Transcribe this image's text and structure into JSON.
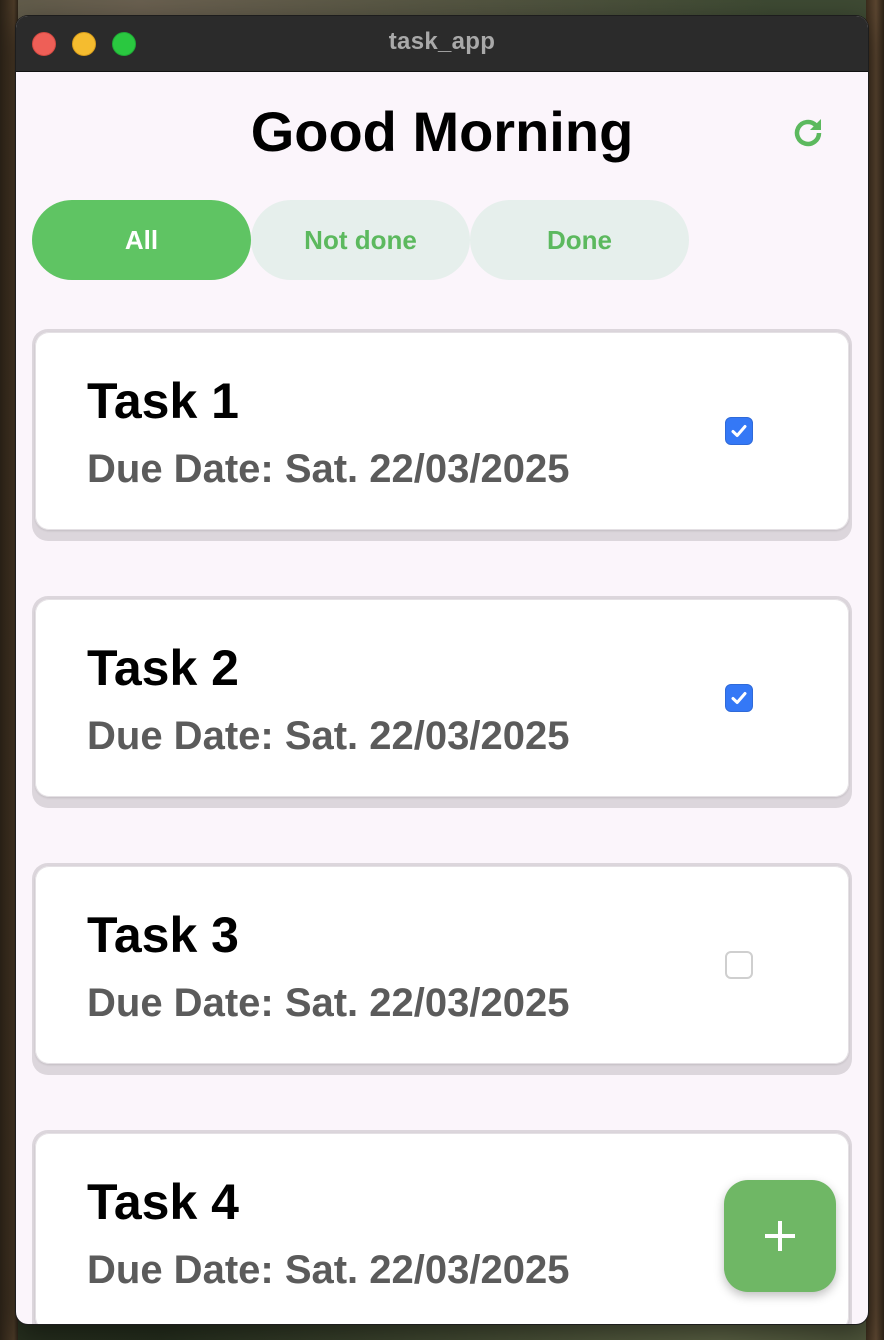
{
  "window": {
    "title": "task_app",
    "controls": [
      "close",
      "minimize",
      "maximize"
    ]
  },
  "header": {
    "greeting": "Good Morning",
    "refresh_icon": "refresh-icon"
  },
  "filters": [
    {
      "label": "All",
      "active": true
    },
    {
      "label": "Not done",
      "active": false
    },
    {
      "label": "Done",
      "active": false
    }
  ],
  "tasks": [
    {
      "title": "Task 1",
      "due": "Due Date: Sat. 22/03/2025",
      "done": true
    },
    {
      "title": "Task 2",
      "due": "Due Date: Sat. 22/03/2025",
      "done": true
    },
    {
      "title": "Task 3",
      "due": "Due Date: Sat. 22/03/2025",
      "done": false
    },
    {
      "title": "Task 4",
      "due": "Due Date: Sat. 22/03/2025",
      "done": null
    }
  ],
  "fab": {
    "icon": "plus-icon"
  },
  "colors": {
    "accent": "#5fc463",
    "chip_inactive_bg": "#e6efec",
    "checkbox_checked": "#3478f6",
    "fab": "#6fb765",
    "background": "#fbf5fb"
  }
}
